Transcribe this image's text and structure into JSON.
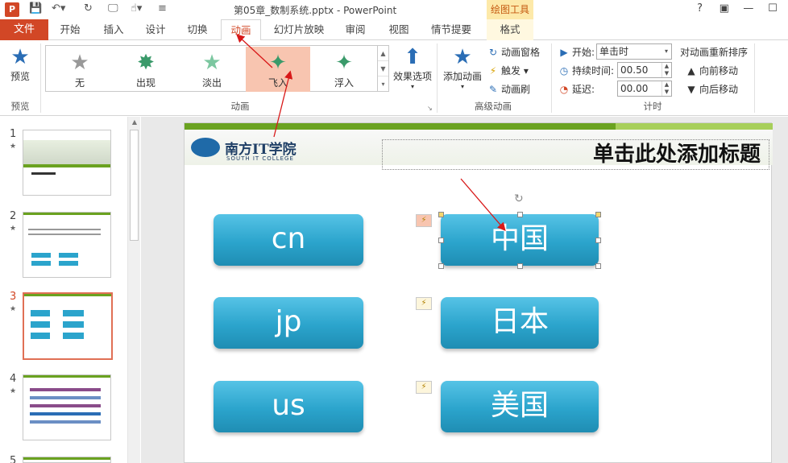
{
  "app": {
    "window_title": "第05章_数制系统.pptx - PowerPoint",
    "drawing_tools_label": "绘图工具",
    "app_icon_letter": "P",
    "help": "?",
    "ribbon_display": "▣",
    "minimize": "—",
    "restore": "☐"
  },
  "tabs": {
    "file": "文件",
    "items": [
      "开始",
      "插入",
      "设计",
      "切换",
      "动画",
      "幻灯片放映",
      "审阅",
      "视图",
      "情节提要",
      "格式"
    ],
    "active": "动画"
  },
  "ribbon": {
    "preview": {
      "label": "预览",
      "group": "预览"
    },
    "animation_group": "动画",
    "gallery": [
      {
        "label": "无"
      },
      {
        "label": "出现"
      },
      {
        "label": "淡出"
      },
      {
        "label": "飞入",
        "selected": true
      },
      {
        "label": "浮入"
      }
    ],
    "effect_options": "效果选项",
    "advanced": {
      "add_animation": "添加动画",
      "animation_pane": "动画窗格",
      "trigger": "触发",
      "animation_painter": "动画刷",
      "group": "高级动画"
    },
    "timing": {
      "start_label": "开始:",
      "start_value": "单击时",
      "duration_label": "持续时间:",
      "duration_value": "00.50",
      "delay_label": "延迟:",
      "delay_value": "00.00",
      "group": "计时"
    },
    "reorder": {
      "title": "对动画重新排序",
      "move_earlier": "向前移动",
      "move_later": "向后移动"
    }
  },
  "thumbnails": [
    {
      "number": "1",
      "star": "★"
    },
    {
      "number": "2",
      "star": "★"
    },
    {
      "number": "3",
      "star": "★",
      "active": true
    },
    {
      "number": "4",
      "star": "★"
    },
    {
      "number": "5"
    }
  ],
  "slide": {
    "logo_cn": "南方IT学院",
    "logo_en": "SOUTH IT COLLEGE",
    "title_placeholder": "单击此处添加标题",
    "left_boxes": [
      "cn",
      "jp",
      "us"
    ],
    "right_boxes": [
      "中国",
      "日本",
      "美国"
    ],
    "anim_tag_icon": "⚡"
  },
  "colors": {
    "accent": "#d24726",
    "box_blue": "#2ba4cc",
    "selected_gallery": "#f8c5b0",
    "slide_green": "#6aa220"
  }
}
